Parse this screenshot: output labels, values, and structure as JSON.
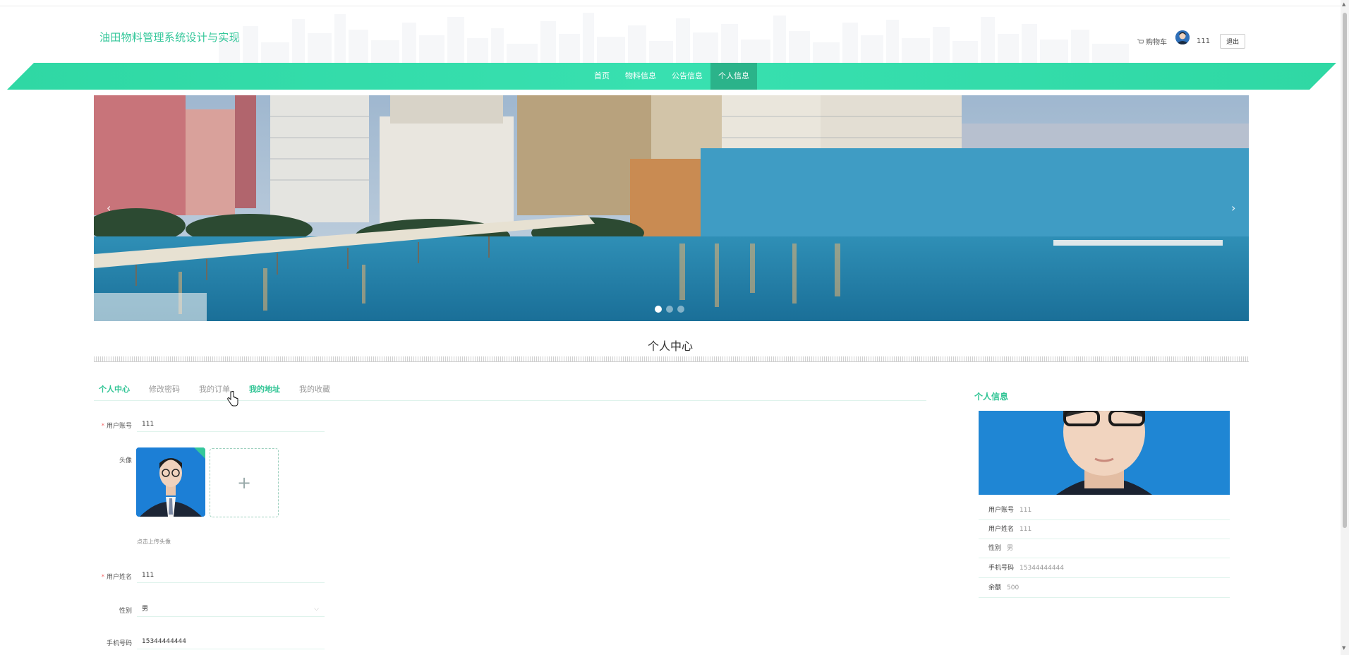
{
  "header": {
    "site_title": "油田物料管理系统设计与实现",
    "cart_label": "购物车",
    "username": "111",
    "logout_label": "退出"
  },
  "nav": {
    "items": [
      "首页",
      "物料信息",
      "公告信息",
      "个人信息"
    ],
    "active_index": 3
  },
  "banner": {
    "slides": 3,
    "active_slide": 1,
    "prev_glyph": "‹",
    "next_glyph": "›"
  },
  "section_title": "个人中心",
  "tabs": {
    "items": [
      "个人中心",
      "修改密码",
      "我的订单",
      "我的地址",
      "我的收藏"
    ],
    "active": [
      "个人中心",
      "我的地址"
    ]
  },
  "form": {
    "account_label": "用户账号",
    "account_value": "111",
    "avatar_label": "头像",
    "upload_plus": "+",
    "upload_hint": "点击上传头像",
    "name_label": "用户姓名",
    "name_value": "111",
    "gender_label": "性别",
    "gender_value": "男",
    "phone_label": "手机号码",
    "phone_value": "15344444444"
  },
  "panel": {
    "title": "个人信息",
    "rows": [
      {
        "key": "用户账号",
        "value": "111"
      },
      {
        "key": "用户姓名",
        "value": "111"
      },
      {
        "key": "性别",
        "value": "男"
      },
      {
        "key": "手机号码",
        "value": "15344444444"
      },
      {
        "key": "余额",
        "value": "500"
      }
    ]
  },
  "colors": {
    "accent": "#2fc494",
    "nav": "#38e0b0",
    "nav_active": "#2bb38a"
  }
}
